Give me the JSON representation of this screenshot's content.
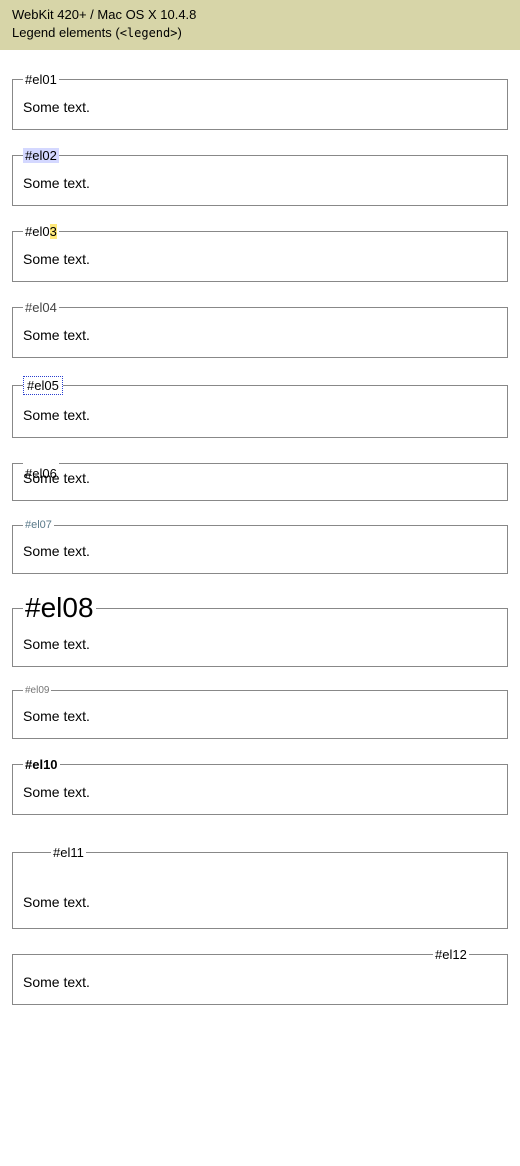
{
  "header": {
    "title": "WebKit 420+ / Mac OS X 10.4.8",
    "subtitle_prefix": "Legend elements (",
    "subtitle_code": "<legend>",
    "subtitle_suffix": ")"
  },
  "body_text": "Some text.",
  "examples": [
    {
      "id": "el01",
      "legend": "#el01",
      "variant": "plain"
    },
    {
      "id": "el02",
      "legend": "#el02",
      "variant": "bg-highlight"
    },
    {
      "id": "el03",
      "legend_prefix": "#el0",
      "legend_highlight": "3",
      "variant": "partial-highlight"
    },
    {
      "id": "el04",
      "legend": "#el04",
      "variant": "muted"
    },
    {
      "id": "el05",
      "legend": "#el05",
      "variant": "dotted-border"
    },
    {
      "id": "el06",
      "legend": "#el06",
      "variant": "overlap"
    },
    {
      "id": "el07",
      "legend": "#el07",
      "variant": "small-teal"
    },
    {
      "id": "el08",
      "legend": "#el08",
      "variant": "large"
    },
    {
      "id": "el09",
      "legend": "#el09",
      "variant": "tiny"
    },
    {
      "id": "el10",
      "legend": "#el10",
      "variant": "bold"
    },
    {
      "id": "el11",
      "legend": "#el11",
      "variant": "indent-tall"
    },
    {
      "id": "el12",
      "legend": "#el12",
      "variant": "right-align"
    }
  ]
}
